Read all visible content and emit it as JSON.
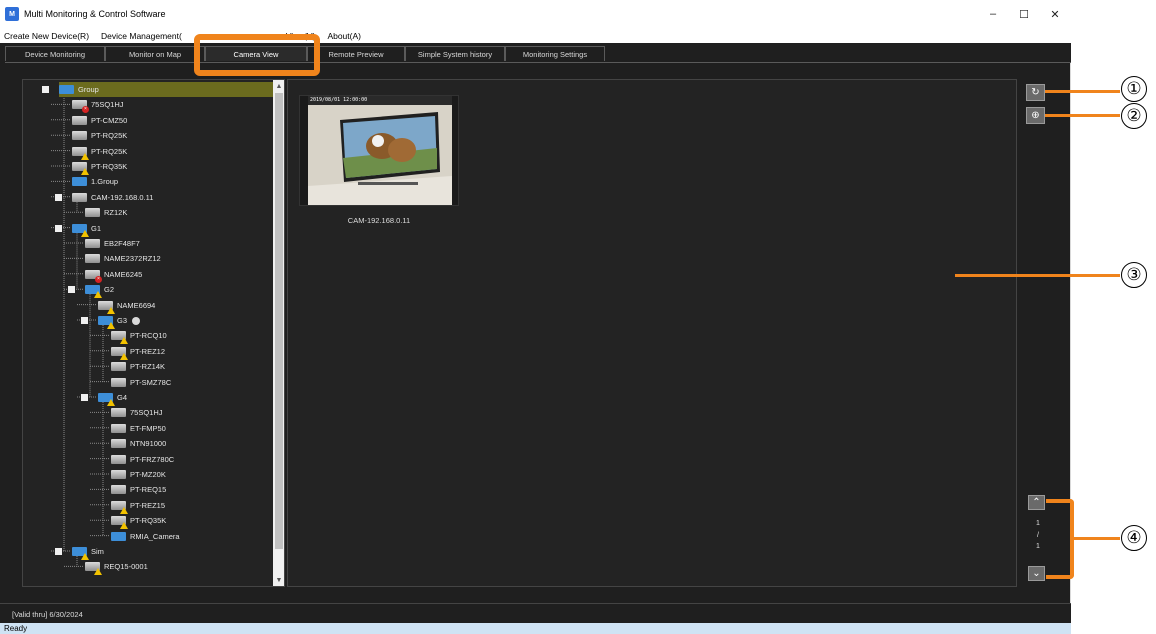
{
  "window": {
    "title": "Multi Monitoring & Control Software",
    "app_icon_text": "M",
    "minimize": "–",
    "maximize": "☐",
    "close": "✕"
  },
  "menu": [
    "Create New Device(R)",
    "Device Management(",
    "View(V)",
    "About(A)"
  ],
  "tabs": [
    {
      "label": "Device Monitoring"
    },
    {
      "label": "Monitor on Map"
    },
    {
      "label": "Camera View"
    },
    {
      "label": "Remote Preview"
    },
    {
      "label": "Simple System history"
    },
    {
      "label": "Monitoring Settings"
    }
  ],
  "tree": [
    {
      "label": "Group",
      "level": 0,
      "type": "folder",
      "expander": "■",
      "selected": true
    },
    {
      "label": "75SQ1HJ",
      "level": 1,
      "type": "device",
      "badge": "err"
    },
    {
      "label": "PT-CMZ50",
      "level": 1,
      "type": "device"
    },
    {
      "label": "PT-RQ25K",
      "level": 1,
      "type": "device"
    },
    {
      "label": "PT-RQ25K",
      "level": 1,
      "type": "device",
      "badge": "warn"
    },
    {
      "label": "PT-RQ35K",
      "level": 1,
      "type": "device",
      "badge": "warn"
    },
    {
      "label": "1.Group",
      "level": 1,
      "type": "folder"
    },
    {
      "label": "CAM-192.168.0.11",
      "level": 1,
      "type": "device",
      "expander": "■"
    },
    {
      "label": "RZ12K",
      "level": 2,
      "type": "device"
    },
    {
      "label": "G1",
      "level": 1,
      "type": "folder",
      "badge": "warn",
      "expander": "■"
    },
    {
      "label": "EB2F48F7",
      "level": 2,
      "type": "device"
    },
    {
      "label": "NAME2372RZ12",
      "level": 2,
      "type": "device"
    },
    {
      "label": "NAME6245",
      "level": 2,
      "type": "device",
      "badge": "err"
    },
    {
      "label": "G2",
      "level": 2,
      "type": "folder",
      "badge": "warn",
      "expander": "■"
    },
    {
      "label": "NAME6694",
      "level": 3,
      "type": "device",
      "badge": "warn"
    },
    {
      "label": "G3",
      "level": 3,
      "type": "folder",
      "badge": "warn",
      "expander": "■",
      "clock": true
    },
    {
      "label": "PT-RCQ10",
      "level": 4,
      "type": "device",
      "badge": "warn"
    },
    {
      "label": "PT-REZ12",
      "level": 4,
      "type": "device",
      "badge": "warn"
    },
    {
      "label": "PT-RZ14K",
      "level": 4,
      "type": "device"
    },
    {
      "label": "PT-SMZ78C",
      "level": 4,
      "type": "device"
    },
    {
      "label": "G4",
      "level": 3,
      "type": "folder",
      "badge": "warn",
      "expander": "■"
    },
    {
      "label": "75SQ1HJ",
      "level": 4,
      "type": "device"
    },
    {
      "label": "ET-FMP50",
      "level": 4,
      "type": "device"
    },
    {
      "label": "NTN91000",
      "level": 4,
      "type": "device"
    },
    {
      "label": "PT-FRZ780C",
      "level": 4,
      "type": "device"
    },
    {
      "label": "PT-MZ20K",
      "level": 4,
      "type": "device"
    },
    {
      "label": "PT-REQ15",
      "level": 4,
      "type": "device"
    },
    {
      "label": "PT-REZ15",
      "level": 4,
      "type": "device",
      "badge": "warn"
    },
    {
      "label": "PT-RQ35K",
      "level": 4,
      "type": "device",
      "badge": "warn"
    },
    {
      "label": "RMIA_Camera",
      "level": 4,
      "type": "folder"
    },
    {
      "label": "Sim",
      "level": 1,
      "type": "folder",
      "badge": "warn",
      "expander": "■"
    },
    {
      "label": "REQ15-0001",
      "level": 2,
      "type": "device",
      "badge": "warn"
    }
  ],
  "camera": {
    "caption": "CAM-192.168.0.11",
    "timestamp": "2019/08/01 12:00:00"
  },
  "buttons": {
    "refresh_icon": "↻",
    "web_icon": "⊕",
    "page_up_icon": "⌃",
    "page_down_icon": "⌄"
  },
  "pager": {
    "current": "1",
    "sep": "/",
    "total": "1"
  },
  "license": {
    "valid_text": "[Valid thru] 6/30/2024"
  },
  "status": {
    "text": "Ready"
  },
  "callouts": [
    "①",
    "②",
    "③",
    "④"
  ],
  "accent_color": "#f0841c"
}
